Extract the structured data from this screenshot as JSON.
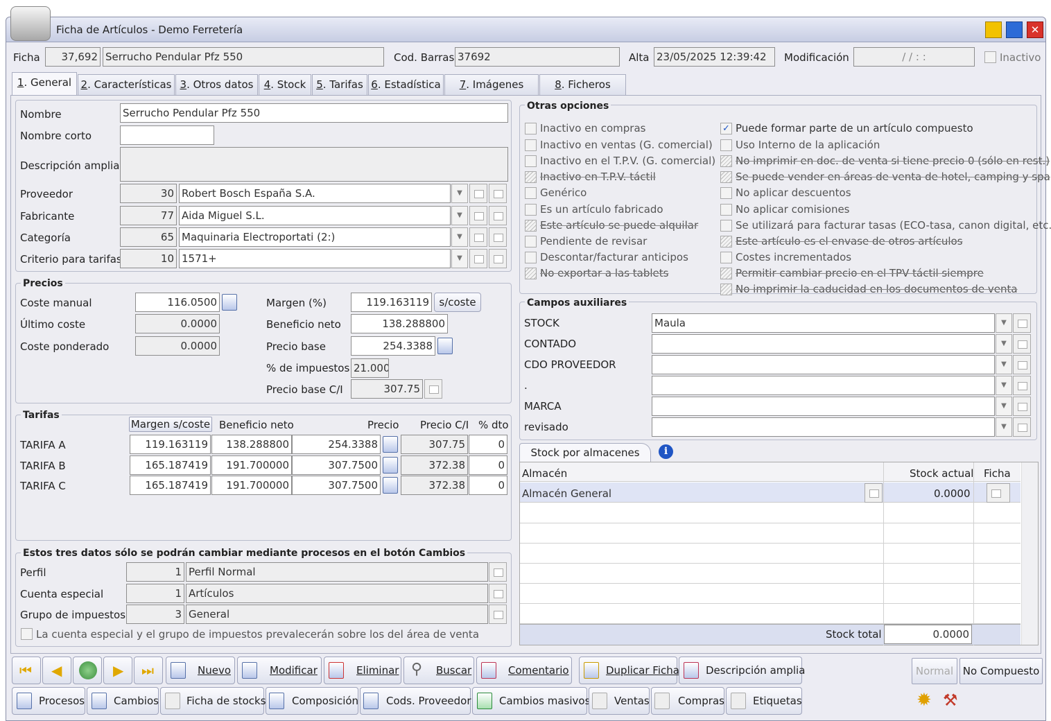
{
  "window": {
    "title": "Ficha de Artículos - Demo Ferretería"
  },
  "header": {
    "ficha_label": "Ficha",
    "ficha_num": "37,692",
    "ficha_name": "Serrucho Pendular Pfz 550",
    "barras_label": "Cod. Barras",
    "barras_value": "37692",
    "alta_label": "Alta",
    "alta_value": "23/05/2025 12:39:42",
    "mod_label": "Modificación",
    "mod_value": "/ /  : :",
    "inactivo_label": "Inactivo"
  },
  "tabs": [
    {
      "k": "1",
      "label": ". General"
    },
    {
      "k": "2",
      "label": ". Características"
    },
    {
      "k": "3",
      "label": ". Otros datos"
    },
    {
      "k": "4",
      "label": ". Stock"
    },
    {
      "k": "5",
      "label": ". Tarifas"
    },
    {
      "k": "6",
      "label": ". Estadística"
    },
    {
      "k": "7",
      "label": ". Imágenes"
    },
    {
      "k": "8",
      "label": ". Ficheros"
    }
  ],
  "general": {
    "nombre_label": "Nombre",
    "nombre": "Serrucho Pendular Pfz 550",
    "corto_label": "Nombre corto",
    "corto": "",
    "desc_label": "Descripción amplia",
    "desc": "",
    "proveedor_label": "Proveedor",
    "proveedor_num": "30",
    "proveedor": "Robert Bosch España S.A.",
    "fabricante_label": "Fabricante",
    "fabricante_num": "77",
    "fabricante": "Aida Miguel S.L.",
    "categoria_label": "Categoría",
    "categoria_num": "65",
    "categoria": "Maquinaria Electroportati (2:)",
    "criterio_label": "Criterio para tarifas",
    "criterio_num": "10",
    "criterio": "1571+"
  },
  "precios": {
    "title": "Precios",
    "coste_manual_label": "Coste manual",
    "coste_manual": "116.0500",
    "ultimo_label": "Último coste",
    "ultimo": "0.0000",
    "ponderado_label": "Coste ponderado",
    "ponderado": "0.0000",
    "margen_label": "Margen (%)",
    "margen": "119.163119",
    "scoste_btn": "s/coste",
    "beneficio_label": "Beneficio neto",
    "beneficio": "138.288800",
    "base_label": "Precio base",
    "base": "254.3388",
    "impuestos_label": "% de impuestos",
    "impuestos": "21.000",
    "baseci_label": "Precio base C/I",
    "baseci": "307.75"
  },
  "tarifas": {
    "title": "Tarifas",
    "headers": [
      "Margen s/coste",
      "Beneficio neto",
      "Precio",
      "Precio C/I",
      "% dto"
    ],
    "rows": [
      {
        "name": "TARIFA A",
        "margen": "119.163119",
        "beneficio": "138.288800",
        "precio": "254.3388",
        "precioci": "307.75",
        "dto": "0"
      },
      {
        "name": "TARIFA B",
        "margen": "165.187419",
        "beneficio": "191.700000",
        "precio": "307.7500",
        "precioci": "372.38",
        "dto": "0"
      },
      {
        "name": "TARIFA C",
        "margen": "165.187419",
        "beneficio": "191.700000",
        "precio": "307.7500",
        "precioci": "372.38",
        "dto": "0"
      }
    ]
  },
  "cambios": {
    "title": "Estos tres datos sólo se podrán cambiar mediante procesos en el botón Cambios",
    "perfil_label": "Perfil",
    "perfil_num": "1",
    "perfil": "Perfil Normal",
    "cuenta_label": "Cuenta especial",
    "cuenta_num": "1",
    "cuenta": "Artículos",
    "grupo_label": "Grupo de impuestos",
    "grupo_num": "3",
    "grupo": "General",
    "prevalece": "La cuenta especial y el grupo de impuestos prevalecerán sobre los del área de venta"
  },
  "opciones": {
    "title": "Otras opciones",
    "left": [
      {
        "label": "Inactivo en compras",
        "state": "off"
      },
      {
        "label": "Inactivo en ventas (G. comercial)",
        "state": "off"
      },
      {
        "label": "Inactivo en el T.P.V. (G. comercial)",
        "state": "off"
      },
      {
        "label": "Inactivo en T.P.V. táctil",
        "state": "dis"
      },
      {
        "label": "Genérico",
        "state": "off"
      },
      {
        "label": "Es un artículo fabricado",
        "state": "off"
      },
      {
        "label": "Este artículo se puede alquilar",
        "state": "dis"
      },
      {
        "label": "Pendiente de revisar",
        "state": "off"
      },
      {
        "label": "Descontar/facturar anticipos",
        "state": "off"
      },
      {
        "label": "No exportar a las tablets",
        "state": "dis"
      }
    ],
    "right": [
      {
        "label": "Puede formar parte de un artículo compuesto",
        "state": "on"
      },
      {
        "label": "Uso Interno de la aplicación",
        "state": "off"
      },
      {
        "label": "No imprimir en doc. de venta si tiene precio 0 (sólo en rest.)",
        "state": "dis"
      },
      {
        "label": "Se puede vender en áreas de venta de hotel, camping y spa",
        "state": "dis"
      },
      {
        "label": "No aplicar descuentos",
        "state": "off"
      },
      {
        "label": "No aplicar comisiones",
        "state": "off"
      },
      {
        "label": "Se utilizará para facturar tasas (ECO-tasa, canon digital, etc.)",
        "state": "off"
      },
      {
        "label": "Este artículo es el envase de otros artículos",
        "state": "dis"
      },
      {
        "label": "Costes incrementados",
        "state": "off"
      },
      {
        "label": "Permitir cambiar precio en el TPV táctil siempre",
        "state": "dis"
      },
      {
        "label": "No imprimir la caducidad en los documentos de venta",
        "state": "dis"
      }
    ]
  },
  "auxiliares": {
    "title": "Campos auxiliares",
    "rows": [
      {
        "label": "STOCK",
        "value": "Maula"
      },
      {
        "label": "CONTADO",
        "value": ""
      },
      {
        "label": "CDO PROVEEDOR",
        "value": ""
      },
      {
        "label": ".",
        "value": ""
      },
      {
        "label": "MARCA",
        "value": ""
      },
      {
        "label": "revisado",
        "value": ""
      }
    ]
  },
  "stock": {
    "tab_label": "Stock por almacenes",
    "headers": [
      "Almacén",
      "Stock actual",
      "Ficha"
    ],
    "rows": [
      {
        "almacen": "Almacén General",
        "stock": "0.0000"
      }
    ],
    "total_label": "Stock total",
    "total": "0.0000"
  },
  "toolbar1": {
    "nuevo": "Nuevo",
    "modificar": "Modificar",
    "eliminar": "Eliminar",
    "buscar": "Buscar",
    "comentario": "Comentario",
    "duplicar": "Duplicar Ficha",
    "descripcion": "Descripción amplia",
    "normal": "Normal",
    "no_compuesto": "No Compuesto"
  },
  "toolbar2": {
    "procesos": "Procesos",
    "cambios": "Cambios",
    "ficha_stocks": "Ficha de stocks",
    "composicion": "Composición",
    "cods_proveedor": "Cods. Proveedor",
    "cambios_masivos": "Cambios masivos",
    "ventas": "Ventas",
    "compras": "Compras",
    "etiquetas": "Etiquetas"
  },
  "colors": {
    "accent": "#1f55c4",
    "title_bg": "#c7cde3",
    "close": "#d9322b",
    "min": "#e8b800"
  }
}
